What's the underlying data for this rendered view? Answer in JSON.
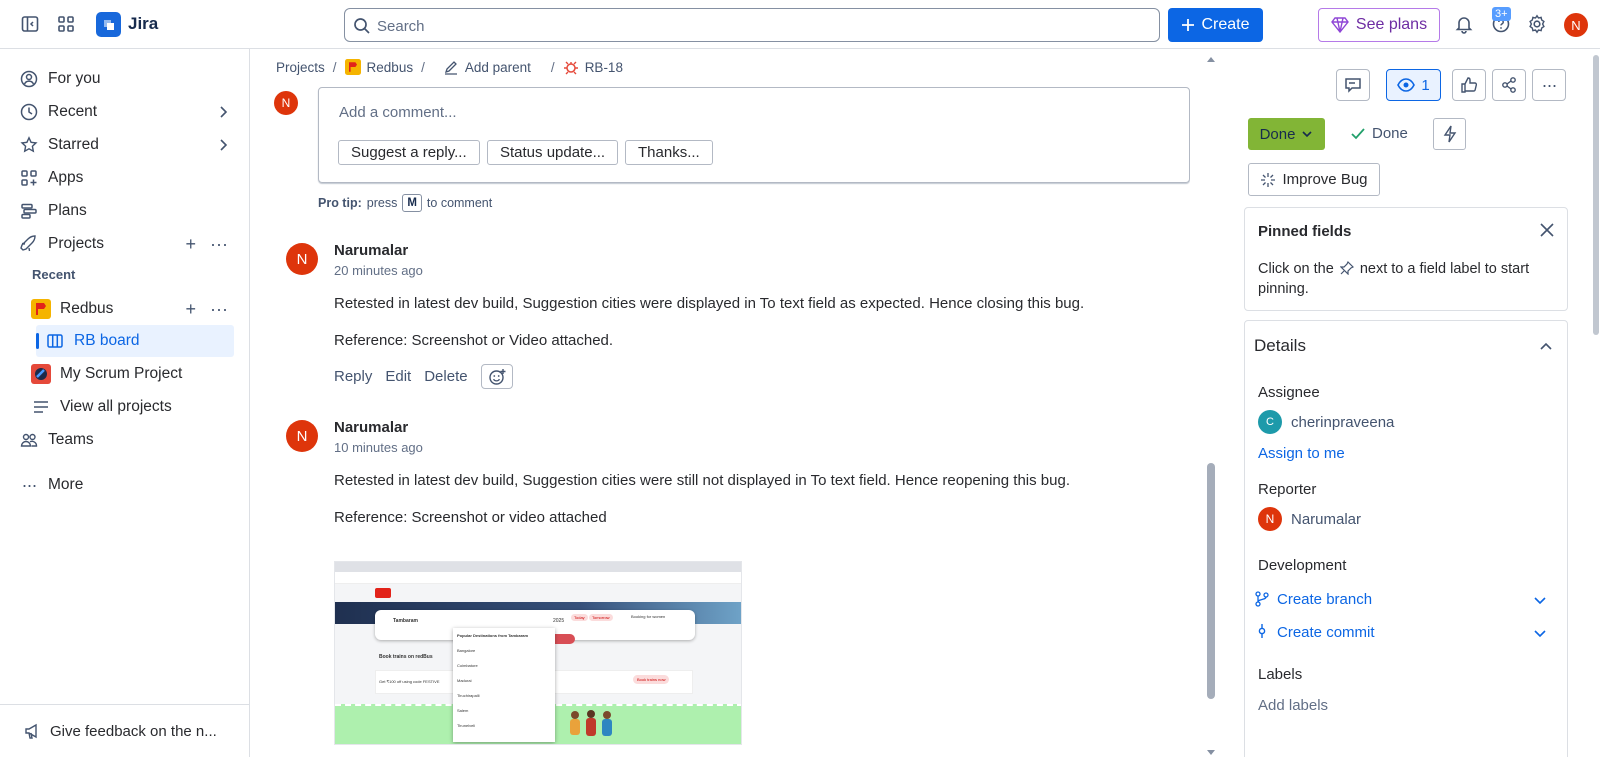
{
  "app": {
    "name": "Jira"
  },
  "search": {
    "placeholder": "Search"
  },
  "topbar": {
    "create_label": "Create",
    "plans_label": "See plans",
    "help_badge": "3+",
    "avatar_initial": "N"
  },
  "sidebar": {
    "for_you": "For you",
    "recent": "Recent",
    "starred": "Starred",
    "apps": "Apps",
    "plans": "Plans",
    "projects": "Projects",
    "recent_label": "Recent",
    "redbus": "Redbus",
    "rb_board": "RB board",
    "scrum": "My Scrum Project",
    "view_all": "View all projects",
    "teams": "Teams",
    "more": "More",
    "feedback": "Give feedback on the n..."
  },
  "breadcrumb": {
    "projects": "Projects",
    "project": "Redbus",
    "add_parent": "Add parent",
    "issue": "RB-18"
  },
  "comment_box": {
    "avatar_initial": "N",
    "placeholder": "Add a comment...",
    "chips": [
      "Suggest a reply...",
      "Status update...",
      "Thanks..."
    ],
    "protip_prefix": "Pro tip:",
    "protip_press": "press",
    "protip_key": "M",
    "protip_suffix": "to comment"
  },
  "comments": [
    {
      "avatar_initial": "N",
      "author": "Narumalar",
      "time": "20 minutes ago",
      "text": "Retested in latest dev build, Suggestion cities were displayed in To text field as expected. Hence closing this bug.",
      "reference": "Reference: Screenshot or Video attached.",
      "actions": [
        "Reply",
        "Edit",
        "Delete"
      ]
    },
    {
      "avatar_initial": "N",
      "author": "Narumalar",
      "time": "10 minutes ago",
      "text": "Retested in latest dev build, Suggestion cities were still not displayed in To text field. Hence reopening this bug.",
      "reference": "Reference: Screenshot or video attached"
    }
  ],
  "thumbnail": {
    "from_city": "Tambaram",
    "date": "2025",
    "chip_today": "Today",
    "chip_tomorrow": "Tomorrow",
    "women_label": "Booking for women",
    "dropdown_title": "Popular Destinations from Tambaram",
    "cities": [
      "Bangalore",
      "Coimbatore",
      "Madurai",
      "Tiruchirapalli",
      "Salem",
      "Tirunelveli"
    ],
    "trains_title": "Book trains on redBus",
    "offer": "Get ₹100 off using code FESTIVE",
    "book_now": "Book trains now"
  },
  "right": {
    "watch_count": "1",
    "status_button": "Done",
    "resolution": "Done",
    "improve": "Improve Bug",
    "pinned": {
      "title": "Pinned fields",
      "text_a": "Click on the",
      "text_b": "next to a field label to start pinning."
    },
    "details": {
      "title": "Details",
      "assignee_label": "Assignee",
      "assignee_initial": "C",
      "assignee": "cherinpraveena",
      "assign_to_me": "Assign to me",
      "reporter_label": "Reporter",
      "reporter_initial": "N",
      "reporter": "Narumalar",
      "development_label": "Development",
      "create_branch": "Create branch",
      "create_commit": "Create commit",
      "labels_label": "Labels",
      "add_labels": "Add labels"
    }
  },
  "colors": {
    "primary": "#0c66e4",
    "done_green": "#82b536",
    "avatar_red": "#de350b",
    "assignee_teal": "#1d9aaa"
  }
}
